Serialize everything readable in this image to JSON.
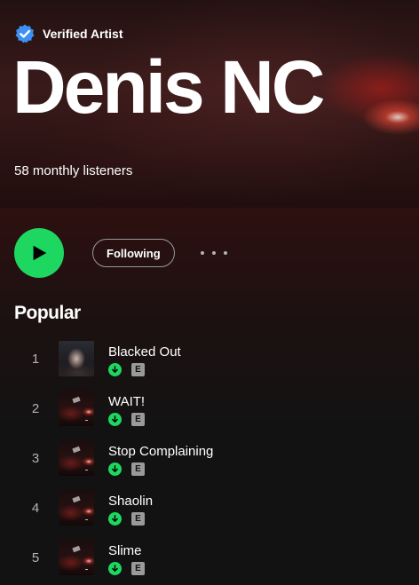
{
  "artist": {
    "verified_label": "Verified Artist",
    "name": "Denis NC",
    "monthly_listeners": "58 monthly listeners"
  },
  "actions": {
    "follow_label": "Following"
  },
  "popular": {
    "title": "Popular",
    "tracks": [
      {
        "number": "1",
        "title": "Blacked Out",
        "explicit": "E"
      },
      {
        "number": "2",
        "title": "WAIT!",
        "explicit": "E"
      },
      {
        "number": "3",
        "title": "Stop Complaining",
        "explicit": "E"
      },
      {
        "number": "4",
        "title": "Shaolin",
        "explicit": "E"
      },
      {
        "number": "5",
        "title": "Slime",
        "explicit": "E"
      }
    ]
  },
  "colors": {
    "accent_green": "#1ed760",
    "verified_blue": "#3d91f4",
    "background": "#121212"
  },
  "icons": [
    "verified-badge-icon",
    "play-icon",
    "more-options-icon",
    "downloaded-icon",
    "explicit-icon"
  ]
}
